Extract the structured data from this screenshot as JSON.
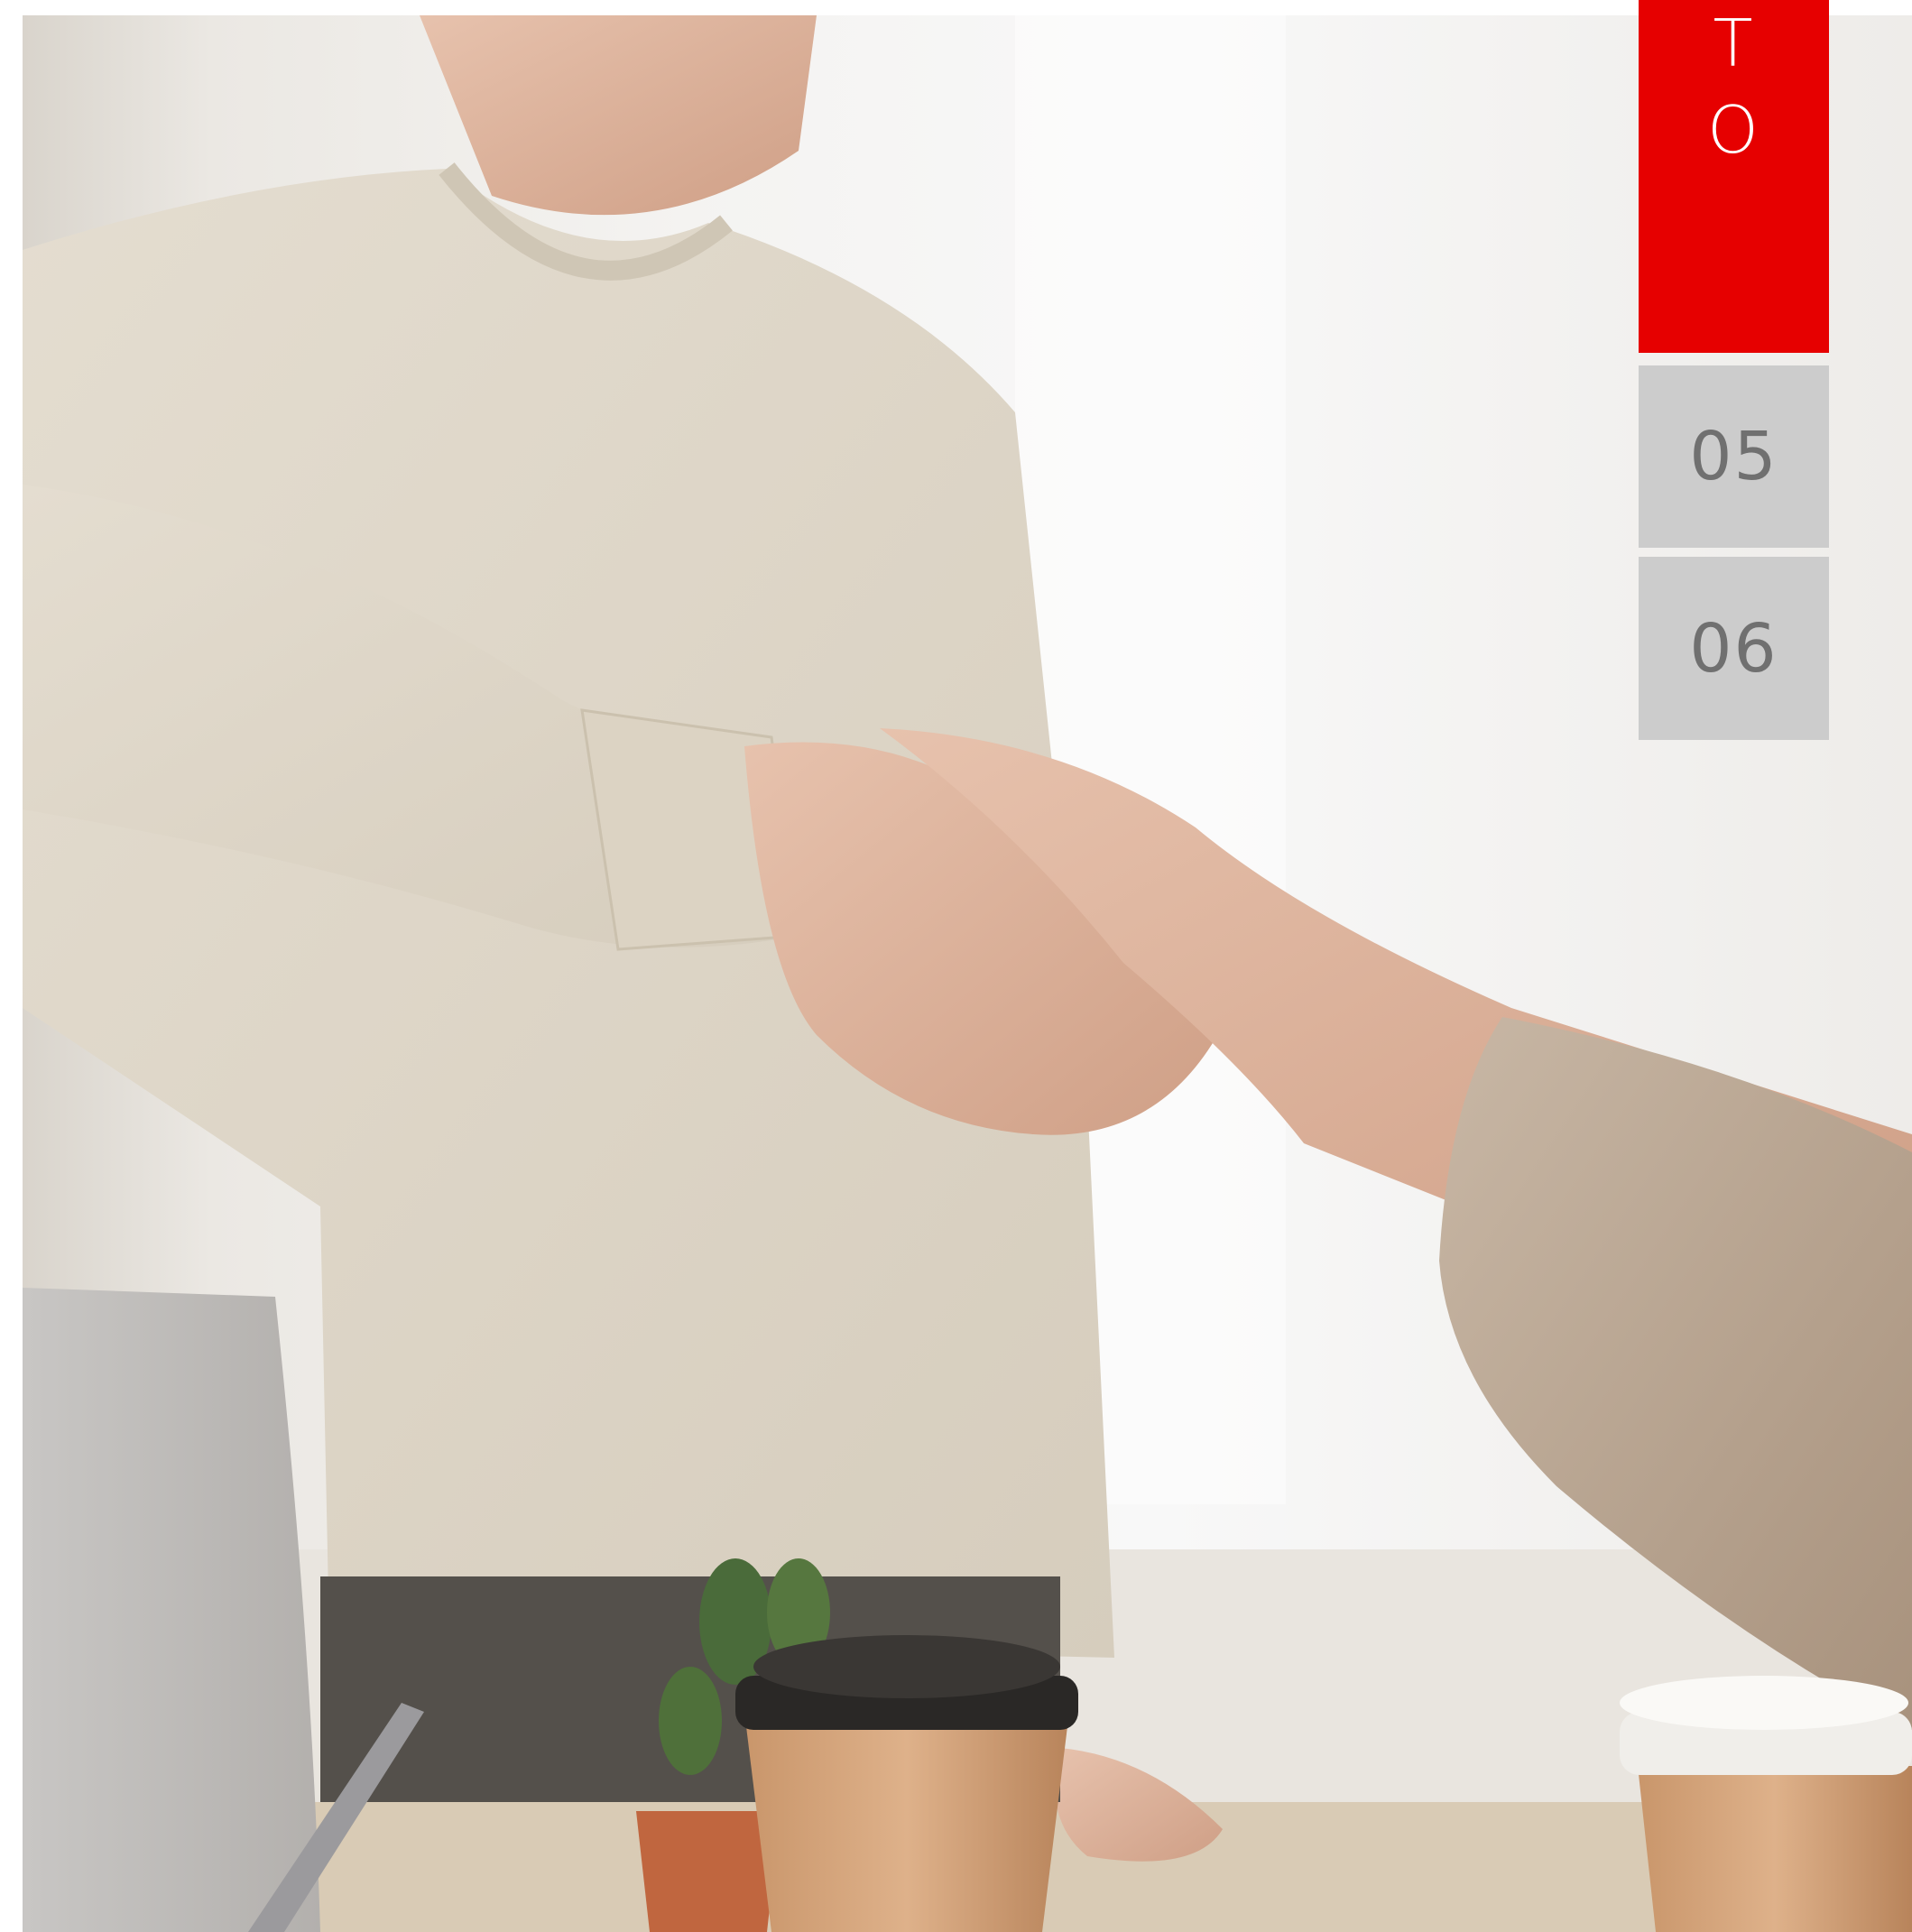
{
  "nav": {
    "active_tab": {
      "letters": [
        "T",
        "O"
      ],
      "color": "#e60000"
    },
    "tabs": [
      {
        "label": "05"
      },
      {
        "label": "06"
      }
    ],
    "inactive_color": "#cccccc"
  },
  "photo": {
    "subject": "handshake-photo"
  }
}
